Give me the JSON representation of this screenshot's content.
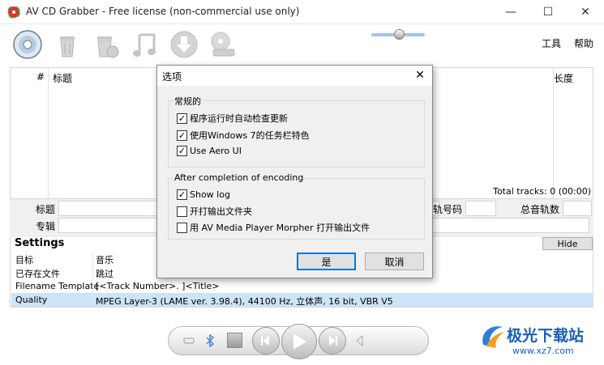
{
  "window": {
    "title": "AV CD Grabber - Free license (non-commercial use only)",
    "minimize_glyph": "—",
    "maximize_glyph": "☐",
    "close_glyph": "✕"
  },
  "toolbar": {
    "icons": [
      "cd-disc-icon",
      "trash-icon",
      "trash-restore-icon",
      "music-icon",
      "download-icon",
      "cd-drive-icon"
    ],
    "menu_tools": "工具",
    "menu_help": "帮助"
  },
  "track_list": {
    "col_number": "#",
    "col_title": "标题",
    "col_length": "长度",
    "total_tracks": "Total tracks: 0 (00:00)"
  },
  "info": {
    "title_label": "标题",
    "album_label": "专辑",
    "track_no_label": "轨号码",
    "total_tracks_label": "总音轨数"
  },
  "settings": {
    "title": "Settings",
    "hide_label": "Hide",
    "rows": [
      {
        "key": "目标",
        "value": "音乐"
      },
      {
        "key": "已存在文件",
        "value": "跳过"
      },
      {
        "key": "Filename Template",
        "value": "[<Track Number>. ]<Title>"
      },
      {
        "key": "Quality",
        "value": "MPEG Layer-3 (LAME ver. 3.98.4), 44100 Hz, 立体声, 16 bit, VBR V5"
      }
    ]
  },
  "dialog": {
    "title": "选项",
    "close_glyph": "✕",
    "group_general": "常规的",
    "opt_check_updates": "程序运行时自动检查更新",
    "opt_taskbar": "使用Windows 7的任务栏特色",
    "opt_aero": "Use Aero UI",
    "group_after": "After completion of encoding",
    "opt_show_log": "Show log",
    "opt_open_folder": "开打输出文件夹",
    "opt_open_player": "用 AV Media Player Morpher 打开输出文件",
    "ok_label": "是",
    "cancel_label": "取消",
    "check_glyph": "✓"
  },
  "watermark": {
    "text": "极光下载站",
    "url": "www.xz7.com"
  }
}
